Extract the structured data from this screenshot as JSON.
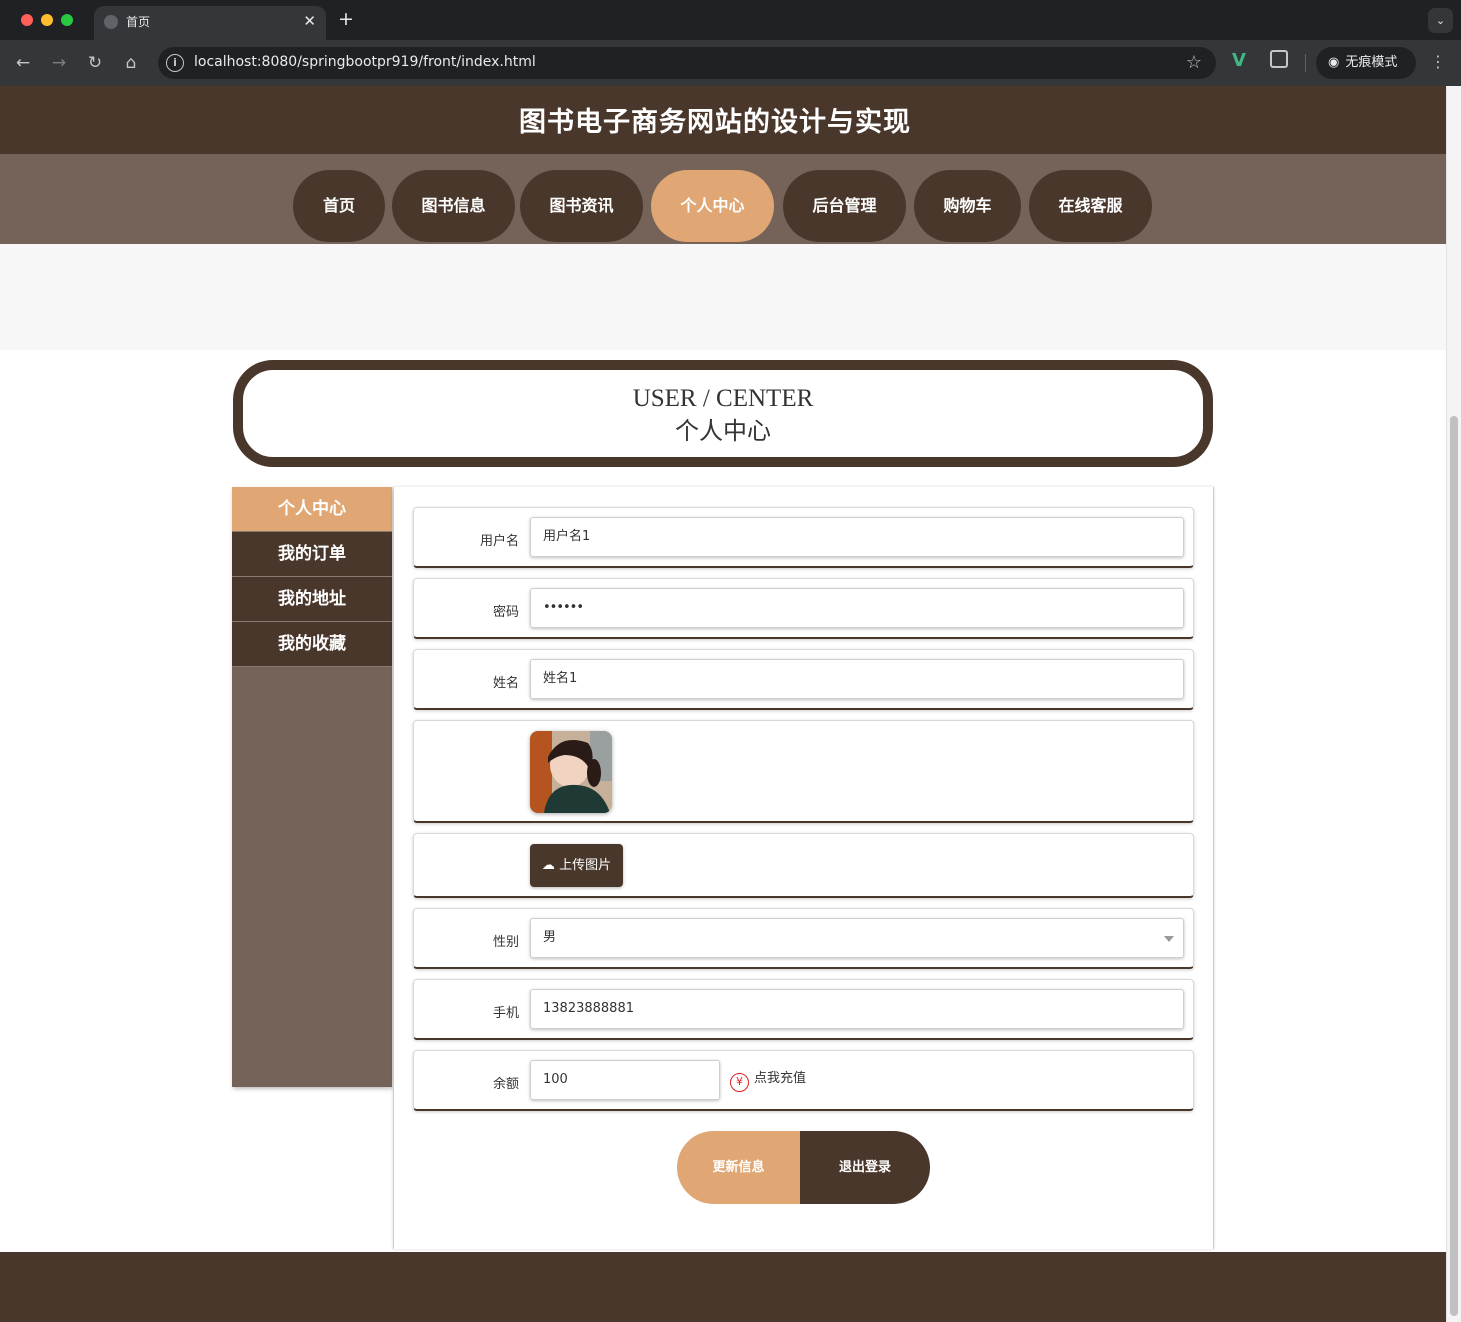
{
  "browser": {
    "tab_title": "首页",
    "tab_close": "✕",
    "new_tab": "+",
    "url": "localhost:8080/springbootpr919/front/index.html",
    "incognito_label": "无痕模式"
  },
  "site": {
    "title": "图书电子商务网站的设计与实现"
  },
  "nav": {
    "items": [
      {
        "label": "首页",
        "active": false
      },
      {
        "label": "图书信息",
        "active": false
      },
      {
        "label": "图书资讯",
        "active": false
      },
      {
        "label": "个人中心",
        "active": true
      },
      {
        "label": "后台管理",
        "active": false
      },
      {
        "label": "购物车",
        "active": false
      },
      {
        "label": "在线客服",
        "active": false
      }
    ]
  },
  "section": {
    "title_en": "USER / CENTER",
    "title_cn": "个人中心"
  },
  "sidebar": {
    "items": [
      {
        "label": "个人中心",
        "active": true
      },
      {
        "label": "我的订单",
        "active": false
      },
      {
        "label": "我的地址",
        "active": false
      },
      {
        "label": "我的收藏",
        "active": false
      }
    ]
  },
  "form": {
    "username": {
      "label": "用户名",
      "value": "用户名1"
    },
    "password": {
      "label": "密码",
      "value": "••••••"
    },
    "name": {
      "label": "姓名",
      "value": "姓名1"
    },
    "upload_label": "上传图片",
    "gender": {
      "label": "性别",
      "value": "男"
    },
    "phone": {
      "label": "手机",
      "value": "13823888881"
    },
    "balance": {
      "label": "余额",
      "value": "100",
      "recharge_label": "点我充值",
      "currency_symbol": "¥"
    }
  },
  "actions": {
    "update_label": "更新信息",
    "logout_label": "退出登录"
  },
  "colors": {
    "primary_dark": "#4a372c",
    "nav_bg": "#756259",
    "accent": "#e0a674"
  }
}
